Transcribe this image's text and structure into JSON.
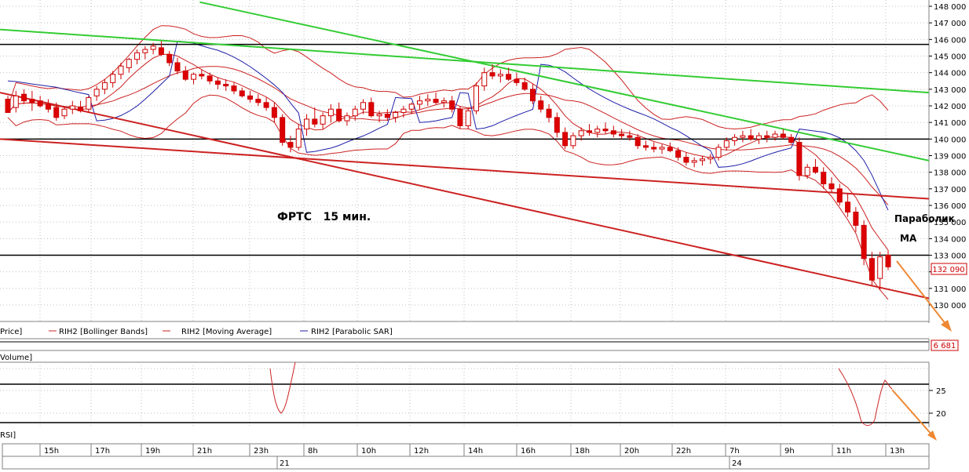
{
  "chart_data": [
    {
      "type": "candlestick",
      "title": "ФРТС   15 мин.",
      "ylim": [
        129000,
        148000
      ],
      "y_ticks": [
        130000,
        131000,
        132000,
        133000,
        134000,
        135000,
        136000,
        137000,
        138000,
        139000,
        140000,
        141000,
        142000,
        143000,
        144000,
        145000,
        146000,
        147000,
        148000
      ],
      "y_tick_labels": [
        "130 000",
        "131 000",
        "132 000",
        "133 000",
        "134 000",
        "135 000",
        "136 000",
        "137 000",
        "138 000",
        "139 000",
        "140 000",
        "141 000",
        "142 000",
        "143 000",
        "144 000",
        "145 000",
        "146 000",
        "147 000",
        "148 000"
      ],
      "last_price_label": "132 090",
      "last_price": 132090,
      "horizontal_levels": [
        145700,
        140000,
        133000
      ],
      "legend": [
        "Price]",
        "RIH2 [Bollinger Bands]",
        "RIH2 [Moving Average]",
        "RIH2 [Parabolic SAR]"
      ],
      "annotations": [
        "Параболик",
        "МА"
      ],
      "trendlines": [
        {
          "color": "#33cc33",
          "from": {
            "x": 0,
            "y": 146600
          },
          "to": {
            "x": 1,
            "y": 142800
          }
        },
        {
          "color": "#33cc33",
          "from": {
            "x": 0.215,
            "y": 148250
          },
          "to": {
            "x": 1,
            "y": 138700
          }
        },
        {
          "color": "#cc2222",
          "from": {
            "x": 0,
            "y": 140000
          },
          "to": {
            "x": 1,
            "y": 136400
          }
        },
        {
          "color": "#cc2222",
          "from": {
            "x": 0,
            "y": 142800
          },
          "to": {
            "x": 1,
            "y": 130400
          }
        }
      ],
      "candles": [
        [
          142.4,
          142.6,
          141.8,
          141.6
        ],
        [
          141.9,
          142.9,
          141.6,
          142.6
        ],
        [
          142.7,
          143.0,
          142.1,
          142.3
        ],
        [
          142.4,
          142.9,
          141.7,
          142.2
        ],
        [
          142.3,
          142.6,
          141.9,
          142.0
        ],
        [
          142.1,
          142.4,
          141.6,
          141.8
        ],
        [
          141.9,
          142.2,
          141.1,
          141.3
        ],
        [
          141.4,
          142.0,
          141.2,
          141.8
        ],
        [
          141.8,
          142.3,
          141.5,
          142.0
        ],
        [
          141.9,
          142.3,
          141.6,
          141.7
        ],
        [
          141.8,
          142.6,
          141.6,
          142.5
        ],
        [
          142.6,
          143.2,
          142.3,
          143.0
        ],
        [
          143.0,
          143.6,
          142.7,
          143.4
        ],
        [
          143.4,
          144.1,
          143.1,
          143.9
        ],
        [
          143.9,
          144.6,
          143.6,
          144.4
        ],
        [
          144.3,
          144.9,
          144.0,
          144.8
        ],
        [
          144.8,
          145.4,
          144.5,
          145.2
        ],
        [
          145.2,
          145.6,
          144.8,
          145.4
        ],
        [
          145.4,
          145.8,
          145.1,
          145.6
        ],
        [
          145.5,
          145.9,
          145.0,
          145.1
        ],
        [
          145.1,
          145.3,
          144.4,
          144.6
        ],
        [
          144.6,
          144.9,
          143.9,
          144.1
        ],
        [
          144.1,
          144.4,
          143.5,
          143.6
        ],
        [
          143.6,
          144.0,
          143.3,
          143.9
        ],
        [
          143.9,
          144.2,
          143.6,
          143.8
        ],
        [
          143.8,
          144.0,
          143.3,
          143.5
        ],
        [
          143.5,
          143.7,
          143.0,
          143.3
        ],
        [
          143.3,
          143.6,
          142.9,
          143.2
        ],
        [
          143.2,
          143.4,
          142.7,
          142.9
        ],
        [
          142.9,
          143.1,
          142.5,
          142.6
        ],
        [
          142.6,
          142.9,
          142.2,
          142.4
        ],
        [
          142.4,
          142.7,
          142.0,
          142.2
        ],
        [
          142.2,
          142.5,
          141.7,
          141.9
        ],
        [
          141.9,
          142.2,
          141.0,
          141.3
        ],
        [
          141.3,
          141.5,
          139.6,
          139.8
        ],
        [
          139.8,
          140.2,
          139.2,
          139.5
        ],
        [
          139.5,
          140.9,
          139.3,
          140.6
        ],
        [
          140.6,
          141.5,
          140.2,
          141.2
        ],
        [
          141.2,
          141.9,
          140.7,
          140.9
        ],
        [
          140.9,
          141.6,
          140.6,
          141.4
        ],
        [
          141.4,
          142.1,
          141.0,
          141.8
        ],
        [
          141.8,
          142.2,
          141.0,
          141.1
        ],
        [
          141.1,
          141.6,
          140.8,
          141.4
        ],
        [
          141.4,
          142.0,
          141.1,
          141.8
        ],
        [
          141.8,
          142.4,
          141.5,
          142.2
        ],
        [
          142.2,
          142.5,
          141.3,
          141.4
        ],
        [
          141.4,
          141.7,
          141.0,
          141.5
        ],
        [
          141.5,
          141.8,
          141.1,
          141.3
        ],
        [
          141.3,
          141.7,
          141.0,
          141.6
        ],
        [
          141.6,
          142.0,
          141.3,
          141.8
        ],
        [
          141.8,
          142.2,
          141.5,
          142.1
        ],
        [
          142.1,
          142.6,
          141.8,
          142.3
        ],
        [
          142.3,
          142.7,
          142.0,
          142.4
        ],
        [
          142.4,
          142.8,
          142.1,
          142.2
        ],
        [
          142.2,
          142.5,
          141.9,
          142.3
        ],
        [
          142.3,
          142.6,
          141.6,
          141.8
        ],
        [
          141.8,
          142.0,
          140.6,
          140.8
        ],
        [
          140.8,
          141.9,
          140.6,
          141.7
        ],
        [
          141.7,
          143.4,
          141.5,
          143.2
        ],
        [
          143.2,
          144.3,
          142.9,
          144.0
        ],
        [
          144.0,
          144.5,
          143.6,
          143.8
        ],
        [
          143.8,
          144.2,
          143.4,
          143.9
        ],
        [
          143.9,
          144.3,
          143.5,
          143.6
        ],
        [
          143.6,
          144.0,
          143.2,
          143.4
        ],
        [
          143.4,
          143.7,
          142.9,
          143.0
        ],
        [
          143.0,
          143.3,
          142.1,
          142.3
        ],
        [
          142.3,
          142.6,
          141.6,
          141.8
        ],
        [
          141.8,
          142.1,
          141.0,
          141.3
        ],
        [
          141.3,
          141.6,
          140.1,
          140.4
        ],
        [
          140.4,
          140.7,
          139.4,
          139.6
        ],
        [
          139.6,
          140.4,
          139.4,
          140.2
        ],
        [
          140.2,
          140.7,
          139.9,
          140.5
        ],
        [
          140.5,
          140.9,
          140.2,
          140.4
        ],
        [
          140.4,
          140.8,
          140.1,
          140.6
        ],
        [
          140.6,
          141.0,
          140.3,
          140.5
        ],
        [
          140.5,
          140.8,
          140.1,
          140.3
        ],
        [
          140.3,
          140.6,
          140.0,
          140.2
        ],
        [
          140.2,
          140.5,
          139.9,
          140.1
        ],
        [
          140.1,
          140.3,
          139.4,
          139.6
        ],
        [
          139.6,
          139.9,
          139.3,
          139.5
        ],
        [
          139.5,
          139.8,
          139.2,
          139.4
        ],
        [
          139.4,
          139.7,
          139.1,
          139.5
        ],
        [
          139.5,
          139.8,
          139.2,
          139.3
        ],
        [
          139.3,
          139.5,
          138.7,
          138.9
        ],
        [
          138.9,
          139.2,
          138.4,
          138.6
        ],
        [
          138.6,
          138.9,
          138.3,
          138.7
        ],
        [
          138.7,
          139.0,
          138.4,
          138.8
        ],
        [
          138.8,
          139.1,
          138.5,
          138.9
        ],
        [
          138.9,
          139.7,
          138.7,
          139.5
        ],
        [
          139.5,
          140.1,
          139.3,
          139.9
        ],
        [
          139.9,
          140.3,
          139.6,
          140.1
        ],
        [
          140.1,
          140.5,
          139.8,
          140.2
        ],
        [
          140.2,
          140.6,
          139.9,
          140.0
        ],
        [
          140.0,
          140.4,
          139.7,
          140.2
        ],
        [
          140.2,
          140.5,
          139.8,
          140.1
        ],
        [
          140.1,
          140.5,
          139.9,
          140.3
        ],
        [
          140.3,
          140.6,
          140.0,
          140.1
        ],
        [
          140.1,
          140.3,
          139.7,
          139.8
        ],
        [
          139.8,
          140.1,
          137.5,
          137.8
        ],
        [
          137.8,
          138.5,
          137.6,
          138.3
        ],
        [
          138.3,
          138.8,
          137.9,
          138.0
        ],
        [
          138.0,
          138.3,
          137.0,
          137.3
        ],
        [
          137.3,
          137.7,
          136.8,
          137.0
        ],
        [
          137.0,
          137.3,
          136.0,
          136.2
        ],
        [
          136.2,
          136.7,
          135.3,
          135.6
        ],
        [
          135.6,
          135.9,
          134.4,
          134.8
        ],
        [
          134.8,
          135.1,
          132.4,
          132.8
        ],
        [
          132.8,
          133.2,
          131.2,
          131.5
        ],
        [
          131.6,
          133.2,
          130.9,
          132.9
        ],
        [
          133.0,
          133.3,
          132.1,
          132.3
        ]
      ]
    },
    {
      "type": "line",
      "title": "RSI]",
      "y_ticks": [
        25,
        20
      ],
      "y_tick_labels": [
        "25",
        "20"
      ],
      "horizontal_levels": [
        27,
        17.5
      ],
      "x_labels": [
        "15h",
        "17h",
        "19h",
        "21h",
        "23h",
        "8h",
        "10h",
        "12h",
        "14h",
        "16h",
        "18h",
        "20h",
        "22h",
        "7h",
        "9h",
        "11h",
        "13h"
      ],
      "date_labels": [
        "21",
        "24"
      ]
    }
  ],
  "volume": {
    "label": "Volume]",
    "value_label": "6 681"
  },
  "colors": {
    "bull": "#ffffff",
    "bear": "#dd0000",
    "candle_outline": "#cc0000",
    "green_line": "#33cc33",
    "red_line": "#cc2222",
    "sar": "#1f1fa8",
    "arrow": "#ee8833"
  }
}
